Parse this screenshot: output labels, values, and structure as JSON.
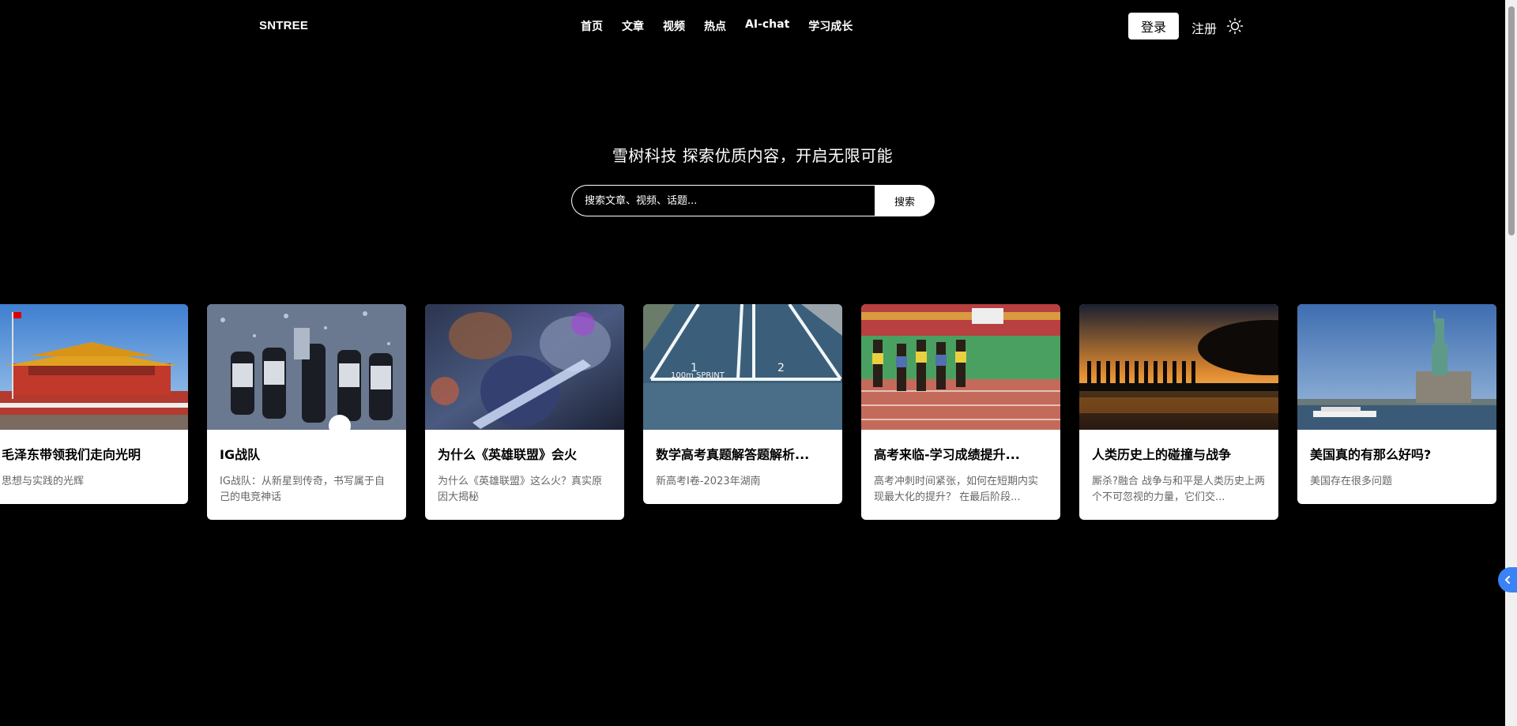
{
  "header": {
    "brand": "SNTREE",
    "nav": [
      {
        "label": "首页"
      },
      {
        "label": "文章"
      },
      {
        "label": "视频"
      },
      {
        "label": "热点"
      },
      {
        "label": "AI-chat"
      },
      {
        "label": "学习成长"
      }
    ],
    "login_label": "登录",
    "register_label": "注册",
    "theme_icon": "sun-icon"
  },
  "hero": {
    "title": "雪树科技 探索优质内容，开启无限可能",
    "search_placeholder": "搜索文章、视频、话题...",
    "search_button": "搜索"
  },
  "cards": [
    {
      "title": "毛泽东带领我们走向光明",
      "desc": "思想与实践的光辉",
      "image": "tiananmen-gate"
    },
    {
      "title": "IG战队",
      "desc": "IG战队：从新星到传奇，书写属于自己的电竞神话",
      "image": "esports-trophy"
    },
    {
      "title": "为什么《英雄联盟》会火",
      "desc": "为什么《英雄联盟》这么火？真实原因大揭秘",
      "image": "game-artwork"
    },
    {
      "title": "数学高考真题解答题解析...",
      "desc": "新高考Ⅰ卷-2023年湖南",
      "image": "running-track"
    },
    {
      "title": "高考来临-学习成绩提升...",
      "desc": "高考冲刺时间紧张，如何在短期内实现最大化的提升？ 在最后阶段...",
      "image": "sprinters"
    },
    {
      "title": "人类历史上的碰撞与战争",
      "desc": "厮杀?融合 战争与和平是人类历史上两个不可忽视的力量，它们交...",
      "image": "soldiers-sunset"
    },
    {
      "title": "美国真的有那么好吗?",
      "desc": "美国存在很多问题",
      "image": "statue-of-liberty"
    }
  ],
  "colors": {
    "background": "#000000",
    "accent": "#3b82f6"
  }
}
